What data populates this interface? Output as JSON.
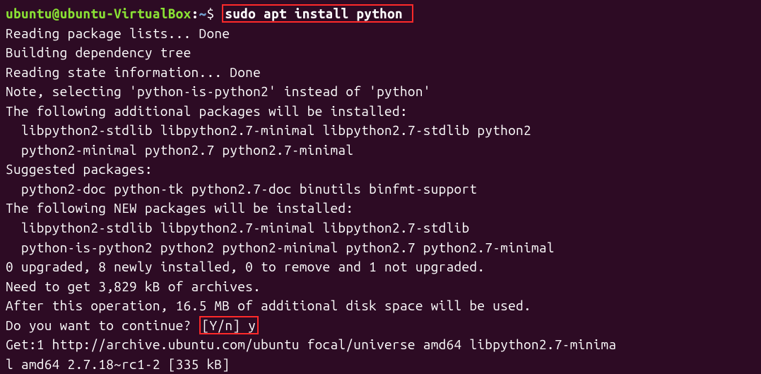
{
  "prompt": {
    "user": "ubuntu@ubuntu-VirtualBox",
    "colon": ":",
    "path": "~",
    "dollar": "$ "
  },
  "command": "sudo apt install python ",
  "output": {
    "l1": "Reading package lists... Done",
    "l2": "Building dependency tree",
    "l3": "Reading state information... Done",
    "l4": "Note, selecting 'python-is-python2' instead of 'python'",
    "l5": "The following additional packages will be installed:",
    "l6": "  libpython2-stdlib libpython2.7-minimal libpython2.7-stdlib python2",
    "l7": "  python2-minimal python2.7 python2.7-minimal",
    "l8": "Suggested packages:",
    "l9": "  python2-doc python-tk python2.7-doc binutils binfmt-support",
    "l10": "The following NEW packages will be installed:",
    "l11": "  libpython2-stdlib libpython2.7-minimal libpython2.7-stdlib",
    "l12": "  python-is-python2 python2 python2-minimal python2.7 python2.7-minimal",
    "l13": "0 upgraded, 8 newly installed, 0 to remove and 1 not upgraded.",
    "l14": "Need to get 3,829 kB of archives.",
    "l15": "After this operation, 16.5 MB of additional disk space will be used."
  },
  "continue_prompt": {
    "prefix": "Do you want to continue? ",
    "choice": "[Y/n] y"
  },
  "get_line": {
    "l16a": "Get:1 http://archive.ubuntu.com/ubuntu focal/universe amd64 libpython2.7-minima",
    "l16b": "l amd64 2.7.18~rc1-2 [335 kB]"
  }
}
